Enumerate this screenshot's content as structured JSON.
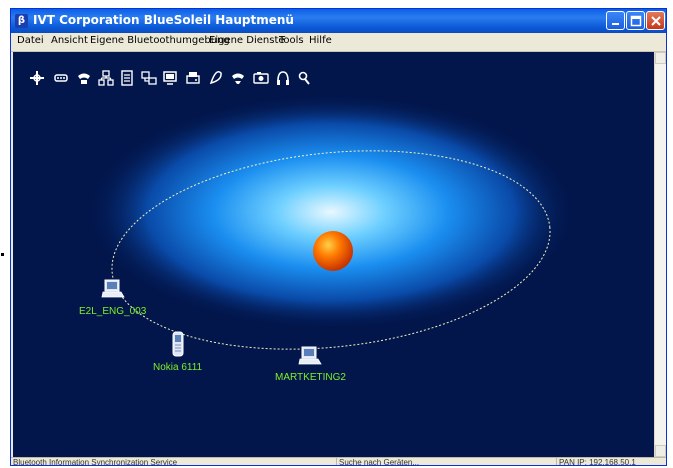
{
  "window": {
    "title": "IVT Corporation BlueSoleil Hauptmenü",
    "app_icon_glyph": "β",
    "controls": [
      "minimize-icon",
      "maximize-icon",
      "close-icon"
    ]
  },
  "menu": {
    "items": [
      "Datei",
      "Ansicht",
      "Eigene Bluetoothumgebung",
      "Eigene Dienste",
      "Tools",
      "Hilfe"
    ]
  },
  "toolbar": {
    "icons": [
      "network-service-icon",
      "serial-port-service-icon",
      "dialup-service-icon",
      "lan-access-icon",
      "file-transfer-icon",
      "personal-network-icon",
      "pc-service-icon",
      "fax-service-icon",
      "printer-service-icon",
      "headset-service-icon",
      "camera-service-icon",
      "audio-gateway-icon",
      "search-service-icon"
    ]
  },
  "devices": [
    {
      "label": "E2L_ENG_003",
      "icon": "laptop-icon"
    },
    {
      "label": "Nokia 6111",
      "icon": "mobile-phone-icon"
    },
    {
      "label": "MARTKETING2",
      "icon": "laptop-icon"
    }
  ],
  "status": {
    "left": "Bluetooth Information Synchronization Service",
    "middle": "Suche nach Geräten...",
    "right": "PAN IP: 192.168.50.1"
  },
  "colors": {
    "canvas_background": "#02164c",
    "device_label": "#7ef025",
    "title_bar": "#0a5fe6",
    "center_ball": "#ff6a00"
  }
}
